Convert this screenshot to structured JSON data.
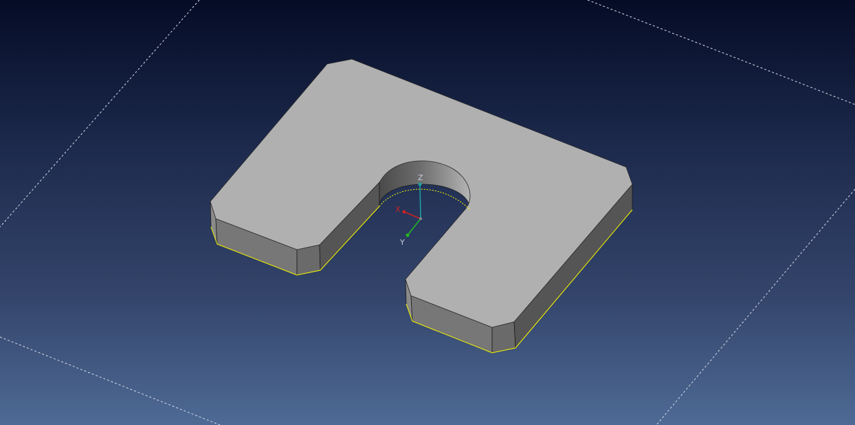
{
  "viewport": {
    "background_top": "#050c26",
    "background_bottom": "#4e6a95"
  },
  "model": {
    "top_face_color": "#b0b0b0",
    "side_face_color": "#7a7a7a",
    "edge_highlight_color": "#ffff00"
  },
  "axis_triad": {
    "x_label": "X",
    "y_label": "Y",
    "z_label": "Z",
    "x_color": "#cc2222",
    "y_color": "#22bb22",
    "z_color": "#1fa3a3"
  }
}
